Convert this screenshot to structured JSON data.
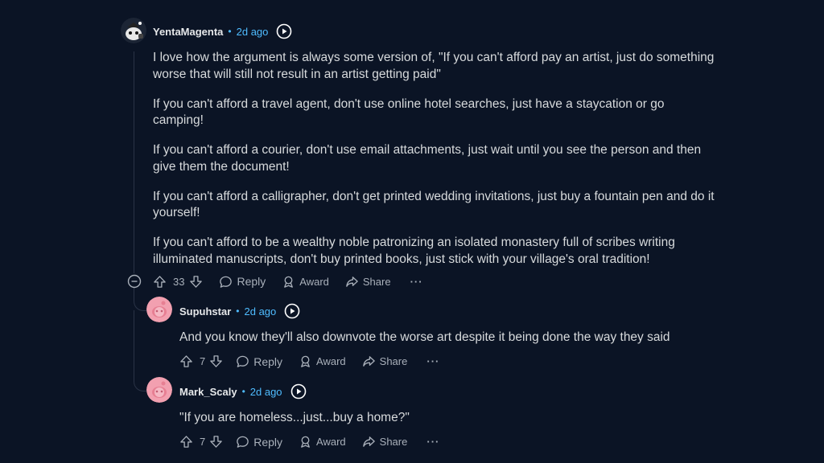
{
  "comments": [
    {
      "username": "YentaMagenta",
      "separator": "•",
      "time": "2d ago",
      "paragraphs": [
        "I love how the argument is always some version of, \"If you can't afford pay an artist, just do something worse that will still not result in an artist getting paid\"",
        "If you can't afford a travel agent, don't use online hotel searches, just have a staycation or go camping!",
        "If you can't afford a courier, don't use email attachments, just wait until you see the person and then give them the document!",
        "If you can't afford a calligrapher, don't get printed wedding invitations, just buy a fountain pen and do it yourself!",
        "If you can't afford to be a wealthy noble patronizing an isolated monastery full of scribes writing illuminated manuscripts, don't buy printed books, just stick with your village's oral tradition!"
      ],
      "votes": "33"
    },
    {
      "username": "Supuhstar",
      "separator": "•",
      "time": "2d ago",
      "text": "And you know they'll also downvote the worse art despite it being done the way they said",
      "votes": "7"
    },
    {
      "username": "Mark_Scaly",
      "separator": "•",
      "time": "2d ago",
      "text": "\"If you are homeless...just...buy a home?\"",
      "votes": "7"
    }
  ],
  "actions": {
    "reply": "Reply",
    "award": "Award",
    "share": "Share",
    "more": "···"
  },
  "colors": {
    "background": "#0b1425",
    "timestamp": "#4fbcff",
    "action_text": "#a9b0ba",
    "pink_avatar": "#f2a0b0"
  }
}
